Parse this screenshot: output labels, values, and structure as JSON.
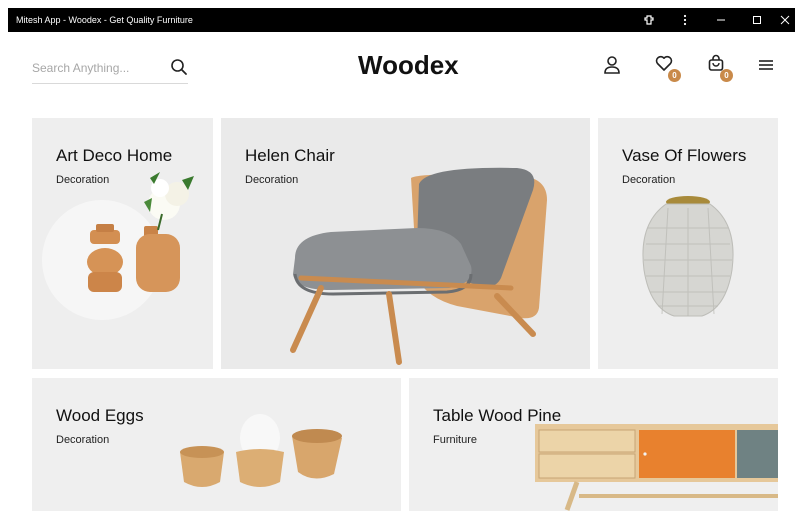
{
  "window": {
    "title": "Mitesh App - Woodex - Get Quality Furniture",
    "controls": [
      "minimize",
      "maximize",
      "close"
    ]
  },
  "header": {
    "brand": "Woodex",
    "search": {
      "placeholder": "Search Anything...",
      "value": ""
    },
    "wishlist_count": "0",
    "cart_count": "0",
    "icons": [
      "user-icon",
      "heart-icon",
      "bag-icon",
      "menu-icon"
    ]
  },
  "products": [
    {
      "title": "Art Deco Home",
      "category": "Decoration"
    },
    {
      "title": "Helen Chair",
      "category": "Decoration"
    },
    {
      "title": "Vase Of Flowers",
      "category": "Decoration"
    },
    {
      "title": "Wood Eggs",
      "category": "Decoration"
    },
    {
      "title": "Table Wood Pine",
      "category": "Furniture"
    }
  ],
  "colors": {
    "accent": "#c98a4a",
    "card_bg": "#eeeeee",
    "titlebar": "#000000"
  }
}
